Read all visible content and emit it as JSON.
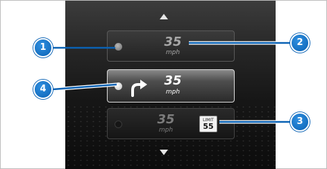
{
  "modes": [
    {
      "speed": "35",
      "unit": "mph",
      "indicator": "inactive-dot"
    },
    {
      "speed": "35",
      "unit": "mph",
      "indicator": "active-dot",
      "icon": "turn-right-arrow-icon"
    },
    {
      "speed": "35",
      "unit": "mph",
      "indicator": "off-dot",
      "limit_sign": {
        "word": "LIMIT",
        "value": "55"
      }
    }
  ],
  "callouts": [
    "1",
    "2",
    "3",
    "4"
  ],
  "colors": {
    "callout": "#0a62b4",
    "screen": "#1e1e1e",
    "highlight_border": "#dcdcdc"
  }
}
